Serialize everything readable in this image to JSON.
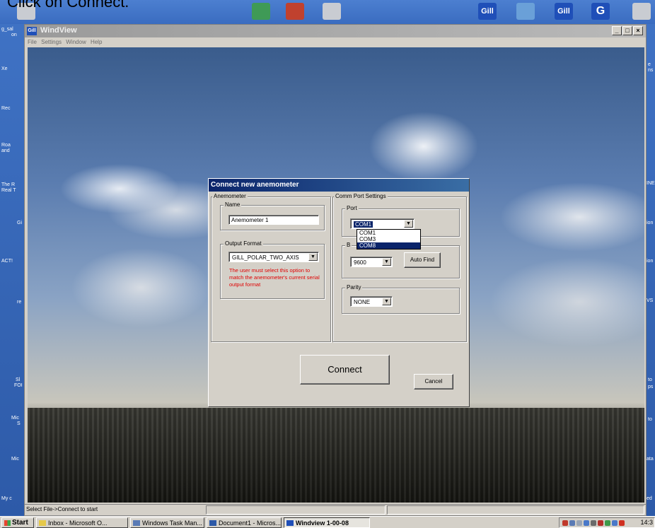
{
  "caption": "Click on Connect.",
  "top_icons": {
    "gill_1": "Gill",
    "gill_2": "Gill",
    "g": "G"
  },
  "side_labels": {
    "left": [
      "g_sal",
      "on",
      "Xe",
      "Rec",
      "Roa",
      "and",
      "The R",
      "Real T",
      "Gi",
      "ACT!",
      "re",
      "Sl",
      "FOI",
      "Mic",
      "S",
      "Mic",
      "My c"
    ],
    "right": [
      "e",
      "ns",
      "INE",
      "ion",
      "ion",
      "VS",
      "to",
      "ps",
      "to",
      "ata",
      "ed"
    ]
  },
  "app": {
    "title": "WindView",
    "icon_text": "Gill",
    "menu": [
      "File",
      "Settings",
      "Window",
      "Help"
    ],
    "window_buttons": [
      "_",
      "□",
      "×"
    ]
  },
  "dialog": {
    "title": "Connect new anemometer",
    "anemometer_group": "Anemometer",
    "name_group": "Name",
    "name_value": "Anemometer 1",
    "output_format_group": "Output Format",
    "output_format_value": "GILL_POLAR_TWO_AXIS",
    "output_format_note": "The user must select this option to match the anemometer's current serial output format",
    "comm_group": "Comm Port Settings",
    "port_group": "Port",
    "port_value": "COM1",
    "port_options": [
      "COM1",
      "COM3",
      "COM8"
    ],
    "port_highlighted": "COM8",
    "baud_group": "B",
    "baud_value": "9600",
    "auto_find_label": "Auto Find",
    "parity_group": "Parity",
    "parity_value": "NONE",
    "connect_label": "Connect",
    "cancel_label": "Cancel"
  },
  "statusbar": {
    "text": "Select File->Connect to start"
  },
  "taskbar": {
    "start_label": "Start",
    "tasks": [
      {
        "label": "Inbox - Microsoft O...",
        "active": false
      },
      {
        "label": "Windows Task Man...",
        "active": false
      },
      {
        "label": "Document1 - Micros...",
        "active": false
      },
      {
        "label": "Windview 1-00-08",
        "active": true
      }
    ],
    "clock": "14:3"
  },
  "colors": {
    "dialog_title": "#0a246a",
    "note_text": "#e00000",
    "selection": "#0a246a"
  }
}
